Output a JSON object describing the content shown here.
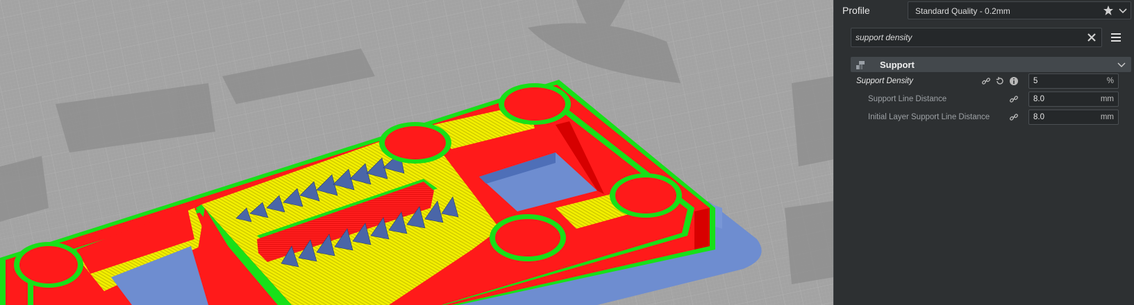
{
  "profile": {
    "label": "Profile",
    "selected": "Standard Quality - 0.2mm",
    "icons": {
      "favorite": "star-icon",
      "dropdown": "chevron-down-icon"
    }
  },
  "search": {
    "value": "support density",
    "icons": {
      "clear": "close-icon",
      "menu": "hamburger-menu-icon"
    }
  },
  "category": {
    "label": "Support",
    "icon": "support-category-icon",
    "expanded": true
  },
  "settings": [
    {
      "label": "Support Density",
      "value": "5",
      "unit": "%",
      "icons": [
        "link-icon",
        "reset-icon",
        "info-icon"
      ]
    },
    {
      "label": "Support Line Distance",
      "value": "8.0",
      "unit": "mm",
      "icons": [
        "link-icon"
      ]
    },
    {
      "label": "Initial Layer Support Line Distance",
      "value": "8.0",
      "unit": "mm",
      "icons": [
        "link-icon"
      ]
    }
  ],
  "colors": {
    "panel_bg": "#2d3032",
    "wall_red": "#ff1a1a",
    "skin_yellow": "#f4f000",
    "outer_green": "#18e018",
    "support_blue": "#6f8fcf",
    "build_plate": "#a2a2a2"
  }
}
